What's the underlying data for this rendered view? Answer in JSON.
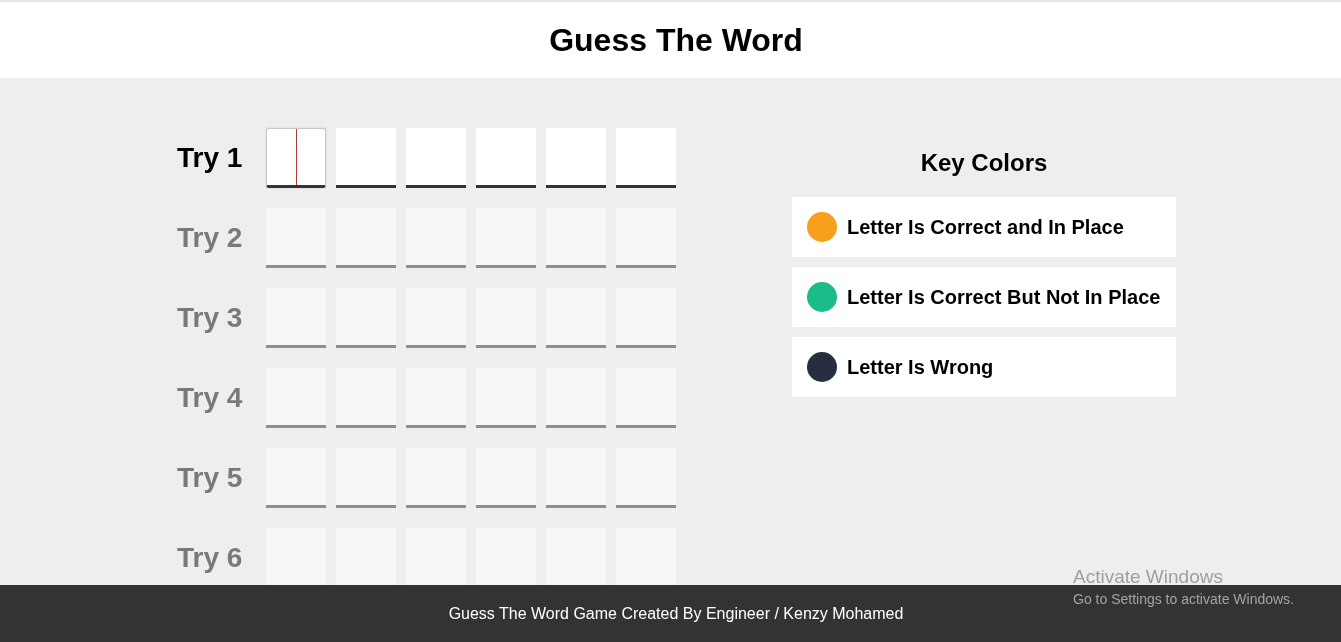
{
  "header": {
    "title": "Guess The Word"
  },
  "tries": [
    {
      "label": "Try 1",
      "disabled": false,
      "cells": [
        {
          "focused": true
        },
        {
          "focused": false
        },
        {
          "focused": false
        },
        {
          "focused": false
        },
        {
          "focused": false
        },
        {
          "focused": false
        }
      ]
    },
    {
      "label": "Try 2",
      "disabled": true,
      "cells": [
        {
          "focused": false
        },
        {
          "focused": false
        },
        {
          "focused": false
        },
        {
          "focused": false
        },
        {
          "focused": false
        },
        {
          "focused": false
        }
      ]
    },
    {
      "label": "Try 3",
      "disabled": true,
      "cells": [
        {
          "focused": false
        },
        {
          "focused": false
        },
        {
          "focused": false
        },
        {
          "focused": false
        },
        {
          "focused": false
        },
        {
          "focused": false
        }
      ]
    },
    {
      "label": "Try 4",
      "disabled": true,
      "cells": [
        {
          "focused": false
        },
        {
          "focused": false
        },
        {
          "focused": false
        },
        {
          "focused": false
        },
        {
          "focused": false
        },
        {
          "focused": false
        }
      ]
    },
    {
      "label": "Try 5",
      "disabled": true,
      "cells": [
        {
          "focused": false
        },
        {
          "focused": false
        },
        {
          "focused": false
        },
        {
          "focused": false
        },
        {
          "focused": false
        },
        {
          "focused": false
        }
      ]
    },
    {
      "label": "Try 6",
      "disabled": true,
      "cells": [
        {
          "focused": false
        },
        {
          "focused": false
        },
        {
          "focused": false
        },
        {
          "focused": false
        },
        {
          "focused": false
        },
        {
          "focused": false
        }
      ]
    }
  ],
  "key_colors": {
    "title": "Key Colors",
    "items": [
      {
        "label": "Letter Is Correct and In Place",
        "color": "#f89f1c"
      },
      {
        "label": "Letter Is Correct But Not In Place",
        "color": "#1bbb8a"
      },
      {
        "label": "Letter Is Wrong",
        "color": "#252f3f"
      }
    ]
  },
  "footer": {
    "text": "Guess The Word Game Created By Engineer / Kenzy Mohamed"
  },
  "os_overlay": {
    "title": "Activate Windows",
    "hint": "Go to Settings to activate Windows."
  }
}
